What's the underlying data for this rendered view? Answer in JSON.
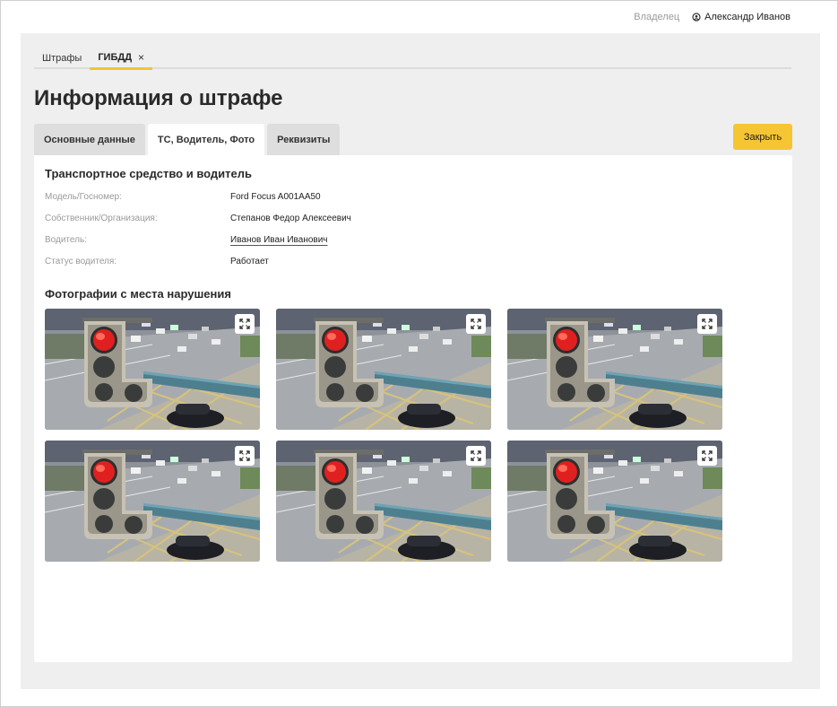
{
  "header": {
    "role_label": "Владелец",
    "user_name": "Александр Иванов"
  },
  "app_tabs": [
    {
      "label": "Штрафы",
      "active": false
    },
    {
      "label": "ГИБДД",
      "active": true,
      "close": "×"
    }
  ],
  "page_title": "Информация о штрафе",
  "sub_tabs": [
    {
      "label": "Основные данные",
      "active": false
    },
    {
      "label": "ТС, Водитель, Фото",
      "active": true
    },
    {
      "label": "Реквизиты",
      "active": false
    }
  ],
  "close_button": "Закрыть",
  "vehicle_section": {
    "title": "Транспортное средство и водитель",
    "rows": [
      {
        "label": "Модель/Госномер:",
        "value": "Ford Focus A001AA50"
      },
      {
        "label": "Собственник/Организация:",
        "value": "Степанов Федор Алексеевич"
      },
      {
        "label": "Водитель:",
        "value": "Иванов Иван Иванович"
      },
      {
        "label": "Статус водителя:",
        "value": "Работает"
      }
    ]
  },
  "photos_section": {
    "title": "Фотографии с места нарушения",
    "photos": [
      {
        "icon": "expand-icon"
      },
      {
        "icon": "expand-icon"
      },
      {
        "icon": "expand-icon"
      },
      {
        "icon": "expand-icon"
      },
      {
        "icon": "expand-icon"
      },
      {
        "icon": "expand-icon"
      }
    ]
  },
  "colors": {
    "accent": "#f6c533",
    "panel_bg": "#efefef",
    "traffic_light_red": "#e02020"
  }
}
